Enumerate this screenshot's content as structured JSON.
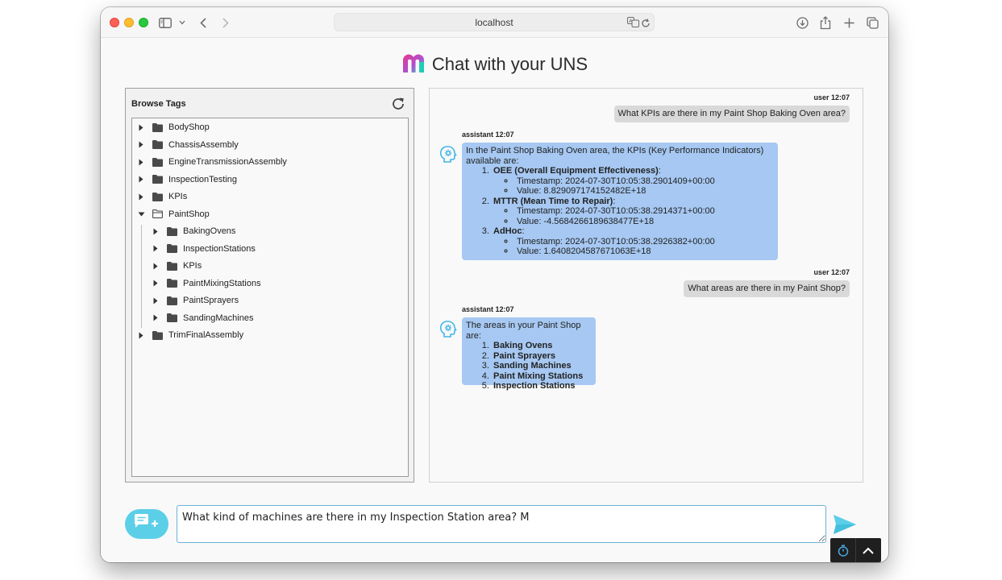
{
  "browser": {
    "url": "localhost"
  },
  "app": {
    "title": "Chat with your UNS",
    "colors": {
      "accent": "#5ccfe8",
      "assistant_bubble": "#a6c8f2",
      "user_bubble": "#d9d9d9"
    }
  },
  "tags": {
    "title": "Browse Tags",
    "refresh_icon": "refresh-icon",
    "tree": [
      {
        "label": "BodyShop",
        "expanded": false
      },
      {
        "label": "ChassisAssembly",
        "expanded": false
      },
      {
        "label": "EngineTransmissionAssembly",
        "expanded": false
      },
      {
        "label": "InspectionTesting",
        "expanded": false
      },
      {
        "label": "KPIs",
        "expanded": false
      },
      {
        "label": "PaintShop",
        "expanded": true,
        "children": [
          {
            "label": "BakingOvens"
          },
          {
            "label": "InspectionStations"
          },
          {
            "label": "KPIs"
          },
          {
            "label": "PaintMixingStations"
          },
          {
            "label": "PaintSprayers"
          },
          {
            "label": "SandingMachines"
          }
        ]
      },
      {
        "label": "TrimFinalAssembly",
        "expanded": false
      }
    ]
  },
  "chat": {
    "messages": [
      {
        "role": "user",
        "meta": "user 12:07",
        "text": "What KPIs are there in my Paint Shop Baking Oven area?"
      },
      {
        "role": "assistant",
        "meta": "assistant 12:07",
        "intro": "In the Paint Shop Baking Oven area, the KPIs (Key Performance Indicators) available are:",
        "items": [
          {
            "name": "OEE (Overall Equipment Effectiveness)",
            "suffix": ":",
            "details": [
              "Timestamp: 2024-07-30T10:05:38.2901409+00:00",
              "Value: 8.829097174152482E+18"
            ]
          },
          {
            "name": "MTTR (Mean Time to Repair)",
            "suffix": ":",
            "details": [
              "Timestamp: 2024-07-30T10:05:38.2914371+00:00",
              "Value: -4.5684266189638477E+18"
            ]
          },
          {
            "name": "AdHoc",
            "suffix": ":",
            "details": [
              "Timestamp: 2024-07-30T10:05:38.2926382+00:00",
              "Value: 1.6408204587671063E+18"
            ]
          }
        ]
      },
      {
        "role": "user",
        "meta": "user 12:07",
        "text": "What areas are there in my Paint Shop?"
      },
      {
        "role": "assistant",
        "meta": "assistant 12:07",
        "intro": "The areas in your Paint Shop are:",
        "items": [
          {
            "name": "Baking Ovens"
          },
          {
            "name": "Paint Sprayers"
          },
          {
            "name": "Sanding Machines"
          },
          {
            "name": "Paint Mixing Stations"
          },
          {
            "name": "Inspection Stations"
          }
        ]
      }
    ]
  },
  "composer": {
    "value": "What kind of machines are there in my Inspection Station area? M",
    "new_chat_icon": "new-chat-icon",
    "send_icon": "send-icon"
  }
}
